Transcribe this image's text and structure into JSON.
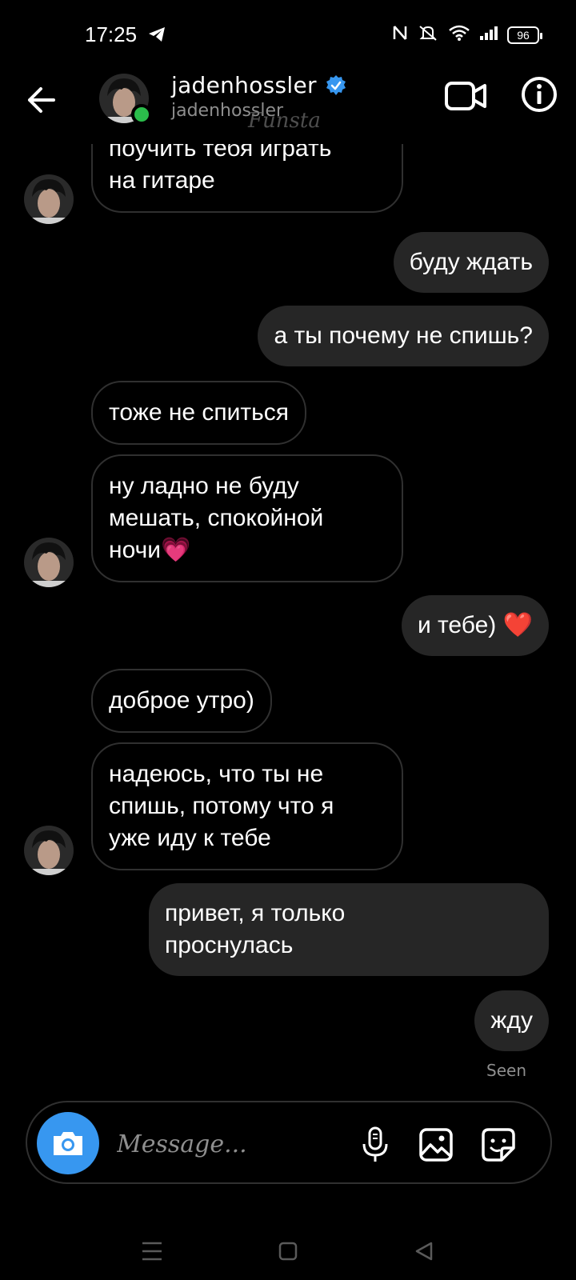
{
  "status_bar": {
    "time": "17:25",
    "battery": "96"
  },
  "header": {
    "username": "jadenhossler",
    "subtitle": "jadenhossler",
    "watermark": "Funsta",
    "verified_color": "#3797f0",
    "online_color": "#2bbd4b"
  },
  "messages": [
    {
      "side": "incoming",
      "text": "поучить тебя играть\nна гитаре"
    },
    {
      "side": "outgoing",
      "text": "буду ждать"
    },
    {
      "side": "outgoing",
      "text": "а ты почему не спишь?"
    },
    {
      "side": "incoming",
      "text": "тоже не спиться"
    },
    {
      "side": "incoming",
      "text": "ну ладно не буду\nмешать, спокойной\nночи💗"
    },
    {
      "side": "outgoing",
      "text": "и тебе) ❤️"
    },
    {
      "side": "incoming",
      "text": "доброе утро)"
    },
    {
      "side": "incoming",
      "text": "надеюсь, что ты не\nспишь, потому что я\nуже иду к тебе"
    },
    {
      "side": "outgoing",
      "text": "привет, я только\nпроснулась"
    },
    {
      "side": "outgoing",
      "text": "жду"
    }
  ],
  "seen_label": "Seen",
  "composer": {
    "placeholder": "Message...",
    "camera_color": "#3797f0"
  },
  "icons": {
    "back": "back-arrow-icon",
    "video": "video-camera-icon",
    "info": "info-icon",
    "mic": "microphone-icon",
    "gallery": "gallery-icon",
    "sticker": "sticker-icon"
  }
}
